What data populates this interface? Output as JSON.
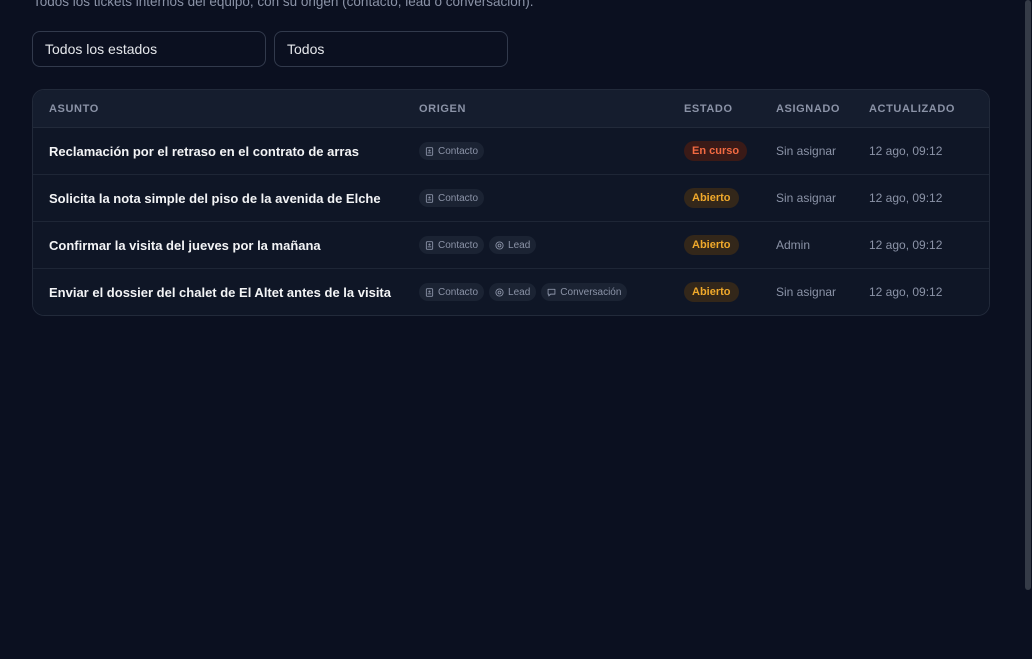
{
  "page": {
    "subtitle": "Todos los tickets internos del equipo, con su origen (contacto, lead o conversación)."
  },
  "filters": {
    "status_select": "Todos los estados",
    "second_select": "Todos"
  },
  "table": {
    "headers": {
      "subject": "ASUNTO",
      "origin": "ORIGEN",
      "state": "ESTADO",
      "assigned": "ASIGNADO",
      "updated": "ACTUALIZADO"
    },
    "origin_labels": {
      "contact": "Contacto",
      "lead": "Lead",
      "conversation": "Conversación"
    },
    "rows": [
      {
        "subject": "Reclamación por el retraso en el contrato de arras",
        "state": "En curso",
        "assigned": "Sin asignar",
        "updated": "12 ago, 09:12"
      },
      {
        "subject": "Solicita la nota simple del piso de la avenida de Elche",
        "state": "Abierto",
        "assigned": "Sin asignar",
        "updated": "12 ago, 09:12"
      },
      {
        "subject": "Confirmar la visita del jueves por la mañana",
        "state": "Abierto",
        "assigned": "Admin",
        "updated": "12 ago, 09:12"
      },
      {
        "subject": "Enviar el dossier del chalet de El Altet antes de la visita",
        "state": "Abierto",
        "assigned": "Sin asignar",
        "updated": "12 ago, 09:12"
      }
    ]
  },
  "colors": {
    "background": "#0b1020",
    "state_en_curso": "#f26a42",
    "state_abierto": "#f0a92b"
  },
  "icons": {
    "contact": "contact-card-icon",
    "lead": "at-sign-icon",
    "conversation": "chat-bubble-icon"
  }
}
